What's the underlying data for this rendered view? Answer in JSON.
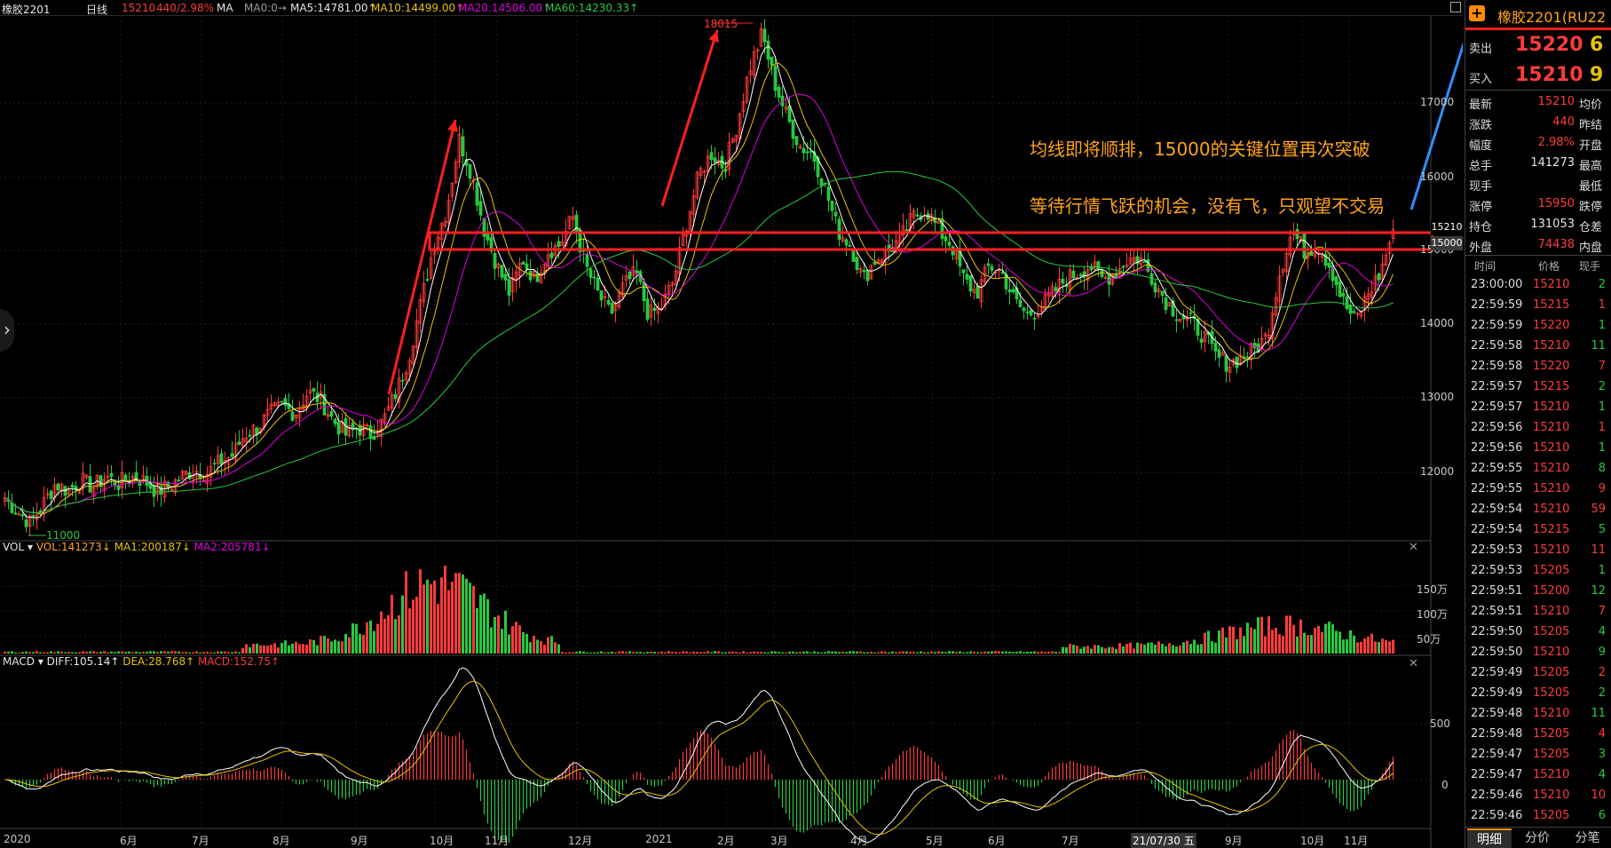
{
  "topbar": {
    "symbol": "橡胶2201",
    "period": "日线",
    "last": "15210",
    "change": "440/2.98%",
    "indicator": "MA",
    "ma0": "MA0:0→",
    "ma5": "MA5:14781.00↑",
    "ma10": "MA10:14499.00↑",
    "ma20": "MA20:14506.00↑",
    "ma60": "MA60:14230.33↑"
  },
  "price_axis": [
    "17000",
    "16000",
    "15000",
    "14000",
    "13000",
    "12000"
  ],
  "price_tags": {
    "current": "15210",
    "level": "15000"
  },
  "annotations": {
    "high": "18015",
    "low": "11000",
    "note_line1": "均线即将顺排，15000的关键位置再次突破",
    "note_line2": "等待行情飞跃的机会，没有飞，只观望不交易"
  },
  "volume_panel": {
    "label": "VOL",
    "vol": "VOL:141273↓",
    "ma1": "MA1:200187↓",
    "ma2": "MA2:205781↓",
    "axis": [
      "150万",
      "100万",
      "50万"
    ]
  },
  "macd_panel": {
    "label": "MACD",
    "diff": "DIFF:105.14↑",
    "dea": "DEA:28.768↑",
    "macd": "MACD:152.75↑",
    "axis": [
      "500",
      "0"
    ]
  },
  "x_axis": [
    "2020",
    "6月",
    "7月",
    "8月",
    "9月",
    "10月",
    "11月",
    "12月",
    "2021",
    "2月",
    "3月",
    "4月",
    "5月",
    "6月",
    "7月",
    "21/07/30 五",
    "9月",
    "10月",
    "11月"
  ],
  "quote": {
    "title": "橡胶2201(RU22",
    "ask_label": "卖出",
    "ask_price": "15220",
    "ask_vol": "6",
    "bid_label": "买入",
    "bid_price": "15210",
    "bid_vol": "9",
    "rows": [
      {
        "l": "最新",
        "v": "15210",
        "r": "均价"
      },
      {
        "l": "涨跌",
        "v": "440",
        "r": "昨结"
      },
      {
        "l": "幅度",
        "v": "2.98%",
        "r": "开盘"
      },
      {
        "l": "总手",
        "v": "141273",
        "r": "最高"
      },
      {
        "l": "现手",
        "v": "",
        "r": "最低"
      },
      {
        "l": "涨停",
        "v": "15950",
        "r": "跌停"
      },
      {
        "l": "持仓",
        "v": "131053",
        "r": "仓差"
      },
      {
        "l": "外盘",
        "v": "74438",
        "r": "内盘"
      }
    ]
  },
  "ticks_header": {
    "time": "时间",
    "price": "价格",
    "vol": "现手"
  },
  "ticks": [
    {
      "t": "23:00:00",
      "p": "15210",
      "v": "2"
    },
    {
      "t": "22:59:59",
      "p": "15215",
      "v": "1"
    },
    {
      "t": "22:59:59",
      "p": "15220",
      "v": "1"
    },
    {
      "t": "22:59:58",
      "p": "15210",
      "v": "11"
    },
    {
      "t": "22:59:58",
      "p": "15220",
      "v": "7"
    },
    {
      "t": "22:59:57",
      "p": "15215",
      "v": "2"
    },
    {
      "t": "22:59:57",
      "p": "15210",
      "v": "1"
    },
    {
      "t": "22:59:56",
      "p": "15210",
      "v": "1"
    },
    {
      "t": "22:59:56",
      "p": "15210",
      "v": "1"
    },
    {
      "t": "22:59:55",
      "p": "15210",
      "v": "8"
    },
    {
      "t": "22:59:55",
      "p": "15210",
      "v": "9"
    },
    {
      "t": "22:59:54",
      "p": "15210",
      "v": "59"
    },
    {
      "t": "22:59:54",
      "p": "15215",
      "v": "5"
    },
    {
      "t": "22:59:53",
      "p": "15210",
      "v": "11"
    },
    {
      "t": "22:59:53",
      "p": "15205",
      "v": "1"
    },
    {
      "t": "22:59:51",
      "p": "15200",
      "v": "12"
    },
    {
      "t": "22:59:51",
      "p": "15210",
      "v": "7"
    },
    {
      "t": "22:59:50",
      "p": "15205",
      "v": "4"
    },
    {
      "t": "22:59:50",
      "p": "15210",
      "v": "9"
    },
    {
      "t": "22:59:49",
      "p": "15205",
      "v": "2"
    },
    {
      "t": "22:59:49",
      "p": "15205",
      "v": "2"
    },
    {
      "t": "22:59:48",
      "p": "15210",
      "v": "11"
    },
    {
      "t": "22:59:48",
      "p": "15205",
      "v": "4"
    },
    {
      "t": "22:59:47",
      "p": "15205",
      "v": "3"
    },
    {
      "t": "22:59:47",
      "p": "15210",
      "v": "4"
    },
    {
      "t": "22:59:46",
      "p": "15210",
      "v": "10"
    },
    {
      "t": "22:59:46",
      "p": "15205",
      "v": "6"
    }
  ],
  "tabs": [
    "明细",
    "分价",
    "分笔"
  ],
  "colors": {
    "up": "#ff3b3b",
    "down": "#27c93f",
    "ma5": "#ffffff",
    "ma10": "#e6c300",
    "ma20": "#e000e0",
    "ma60": "#27c93f",
    "accent": "#ffa31a"
  },
  "chart_data": {
    "type": "candlestick",
    "ylim": [
      10800,
      18200
    ],
    "price_path": [
      11400,
      11200,
      11050,
      11300,
      11600,
      11500,
      11650,
      11550,
      11700,
      11600,
      11700,
      11650,
      11500,
      11550,
      11700,
      11800,
      11750,
      11900,
      12000,
      12300,
      12400,
      12600,
      12700,
      12600,
      12900,
      12800,
      12500,
      12300,
      12400,
      12300,
      12500,
      12900,
      13400,
      14200,
      15000,
      15500,
      16500,
      16000,
      15200,
      14700,
      14300,
      14800,
      14500,
      14900,
      15000,
      15400,
      14700,
      14300,
      14000,
      14400,
      14600,
      14000,
      14100,
      14500,
      15300,
      16000,
      16300,
      16100,
      16700,
      17500,
      18000,
      17300,
      16800,
      16400,
      16300,
      15800,
      15200,
      15000,
      14500,
      14800,
      14900,
      15100,
      15400,
      15500,
      15200,
      15000,
      14500,
      14300,
      14700,
      14600,
      14200,
      14000,
      14100,
      14300,
      14500,
      14600,
      14700,
      14500,
      14600,
      14800,
      14800,
      14500,
      14200,
      14000,
      13900,
      13700,
      13400,
      13300,
      13400,
      13500,
      13700,
      14600,
      15200,
      14900,
      15000,
      14700,
      14200,
      13900,
      14300,
      14600,
      15210
    ]
  }
}
